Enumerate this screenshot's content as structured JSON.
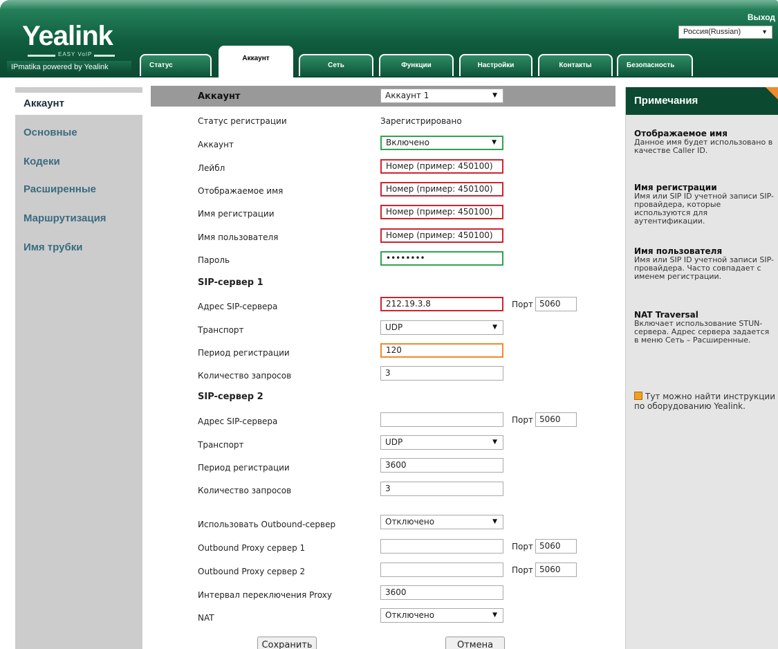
{
  "header": {
    "logo": "Yealink",
    "logo_tagline": "EASY VoIP",
    "logo_sub": "IPmatika powered by Yealink",
    "exit_label": "Выход",
    "language": "Россия(Russian)",
    "colors": {
      "header_dark": "#0b4a31",
      "header_light": "#2a8a61"
    },
    "tabs": [
      {
        "label": "Статус",
        "active": false
      },
      {
        "label": "Аккаунт",
        "active": true
      },
      {
        "label": "Сеть",
        "active": false
      },
      {
        "label": "Функции",
        "active": false
      },
      {
        "label": "Настройки",
        "active": false
      },
      {
        "label": "Контакты",
        "active": false
      },
      {
        "label": "Безопасность",
        "active": false
      }
    ]
  },
  "sidebar": {
    "items": [
      {
        "label": "Аккаунт",
        "active": true
      },
      {
        "label": "Основные",
        "active": false
      },
      {
        "label": "Кодеки",
        "active": false
      },
      {
        "label": "Расширенные",
        "active": false
      },
      {
        "label": "Маршрутизация",
        "active": false
      },
      {
        "label": "Имя трубки",
        "active": false
      }
    ]
  },
  "form": {
    "account_label": "Аккаунт",
    "account_select": "Аккаунт 1",
    "reg_status_label": "Статус регистрации",
    "reg_status_value": "Зарегистрировано",
    "account_enable_label": "Аккаунт",
    "account_enable_value": "Включено",
    "label_label": "Лейбл",
    "label_value": "Номер (пример: 450100)",
    "display_name_label": "Отображаемое имя",
    "display_name_value": "Номер (пример: 450100)",
    "register_name_label": "Имя регистрации",
    "register_name_value": "Номер (пример: 450100)",
    "username_label": "Имя пользователя",
    "username_value": "Номер (пример: 450100)",
    "password_label": "Пароль",
    "password_value": "••••••••",
    "sip1": {
      "title": "SIP-сервер 1",
      "address_label": "Адрес SIP-сервера",
      "address_value": "212.19.3.8",
      "port_label": "Порт",
      "port_value": "5060",
      "transport_label": "Транспорт",
      "transport_value": "UDP",
      "expires_label": "Период регистрации",
      "expires_value": "120",
      "retry_label": "Количество запросов",
      "retry_value": "3"
    },
    "sip2": {
      "title": "SIP-сервер 2",
      "address_label": "Адрес SIP-сервера",
      "address_value": "",
      "port_label": "Порт",
      "port_value": "5060",
      "transport_label": "Транспорт",
      "transport_value": "UDP",
      "expires_label": "Период регистрации",
      "expires_value": "3600",
      "retry_label": "Количество запросов",
      "retry_value": "3"
    },
    "outbound_enable_label": "Использовать Outbound-сервер",
    "outbound_enable_value": "Отключено",
    "proxy1_label": "Outbound Proxy сервер 1",
    "proxy1_value": "",
    "proxy1_port_label": "Порт",
    "proxy1_port_value": "5060",
    "proxy2_label": "Outbound Proxy сервер 2",
    "proxy2_value": "",
    "proxy2_port_label": "Порт",
    "proxy2_port_value": "5060",
    "fallback_label": "Интервал переключения Proxy",
    "fallback_value": "3600",
    "nat_label": "NAT",
    "nat_value": "Отключено",
    "save_label": "Сохранить",
    "cancel_label": "Отмена"
  },
  "notes": {
    "title": "Примечания",
    "items": [
      {
        "title": "Отображаемое имя",
        "text": "Данное имя будет использовано в качестве Caller ID."
      },
      {
        "title": "Имя регистрации",
        "text": "Имя или SIP ID учетной записи SIP-провайдера, которые используются для аутентификации."
      },
      {
        "title": "Имя пользователя",
        "text": "Имя или SIP ID учетной записи SIP-провайдера. Часто совпадает с именем регистрации."
      },
      {
        "title": "NAT Traversal",
        "text": "Включает использование STUN-сервера. Адрес сервера задается в меню Сеть – Расширенные."
      }
    ],
    "help_text": "Тут можно найти инструкции по оборудованию Yealink."
  }
}
